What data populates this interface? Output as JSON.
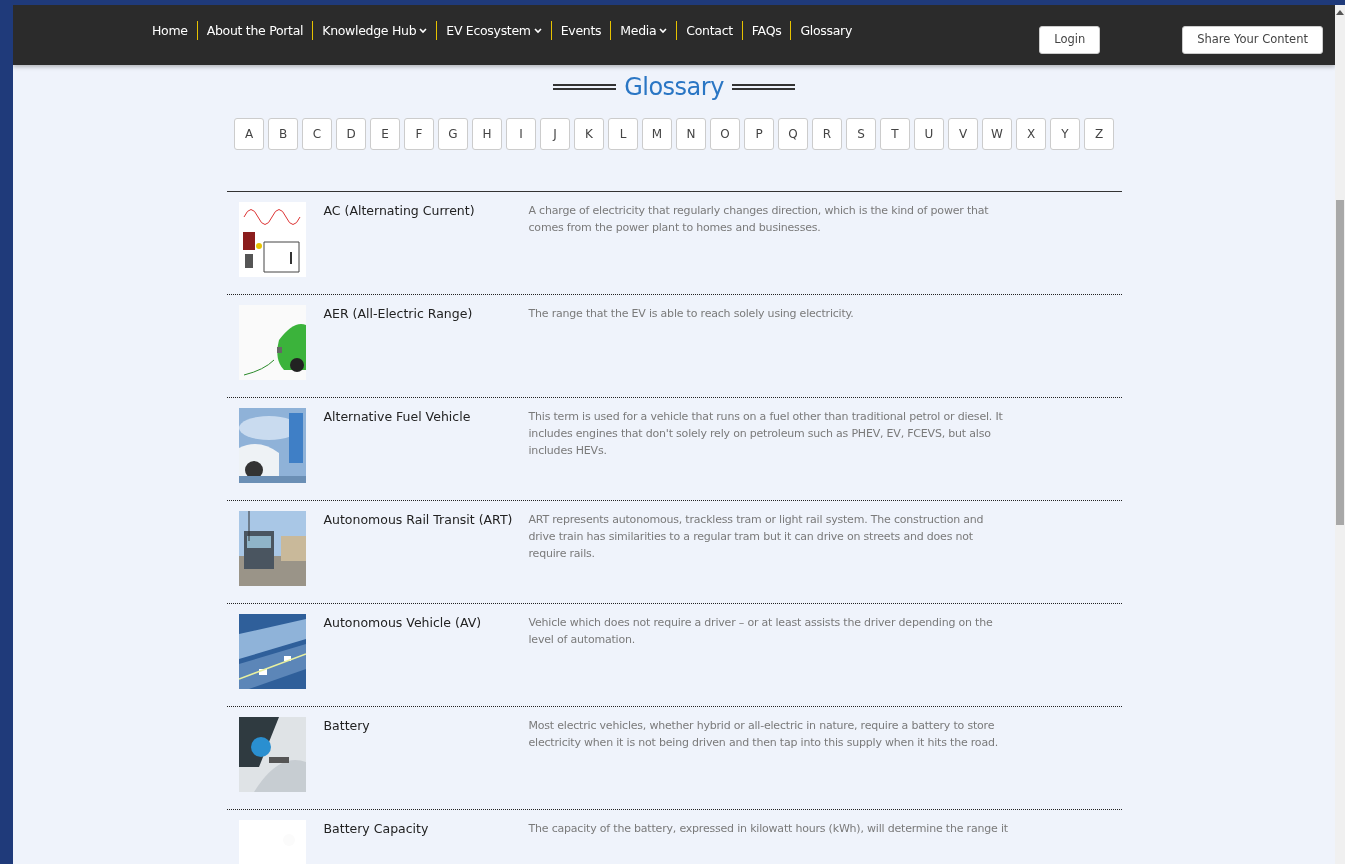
{
  "nav": {
    "items": [
      {
        "label": "Home",
        "dropdown": false
      },
      {
        "label": "About the Portal",
        "dropdown": false
      },
      {
        "label": "Knowledge Hub",
        "dropdown": true
      },
      {
        "label": "EV Ecosystem",
        "dropdown": true
      },
      {
        "label": "Events",
        "dropdown": false
      },
      {
        "label": "Media",
        "dropdown": true
      },
      {
        "label": "Contact",
        "dropdown": false
      },
      {
        "label": "FAQs",
        "dropdown": false
      },
      {
        "label": "Glossary",
        "dropdown": false
      }
    ],
    "buttons": [
      "Login",
      "Share Your Content"
    ]
  },
  "page_title": "Glossary",
  "letters": [
    "A",
    "B",
    "C",
    "D",
    "E",
    "F",
    "G",
    "H",
    "I",
    "J",
    "K",
    "L",
    "M",
    "N",
    "O",
    "P",
    "Q",
    "R",
    "S",
    "T",
    "U",
    "V",
    "W",
    "X",
    "Y",
    "Z"
  ],
  "entries": [
    {
      "term": "AC (Alternating Current)",
      "definition": "A charge of electricity that regularly changes direction, which is the kind of power that comes from the power plant to homes and businesses."
    },
    {
      "term": "AER (All-Electric Range)",
      "definition": "The range that the EV is able to reach solely using electricity."
    },
    {
      "term": "Alternative Fuel Vehicle",
      "definition": "This term is used for a vehicle that runs on a fuel other than traditional petrol or diesel. It includes engines that don't solely rely on petroleum such as PHEV, EV, FCEVS, but also includes HEVs."
    },
    {
      "term": "Autonomous Rail Transit (ART)",
      "definition": "ART represents autonomous, trackless tram or light rail system. The construction and drive train has similarities to a regular tram but it can drive on streets and does not require rails."
    },
    {
      "term": "Autonomous Vehicle (AV)",
      "definition": "Vehicle which does not require a driver – or at least assists the driver depending on the level of automation."
    },
    {
      "term": "Battery",
      "definition": "Most electric vehicles, whether hybrid or all-electric in nature, require a battery to store electricity when it is not being driven and then tap into this supply when it hits the road."
    },
    {
      "term": "Battery Capacity",
      "definition": "The capacity of the battery, expressed in kilowatt hours (kWh), will determine the range it"
    }
  ]
}
